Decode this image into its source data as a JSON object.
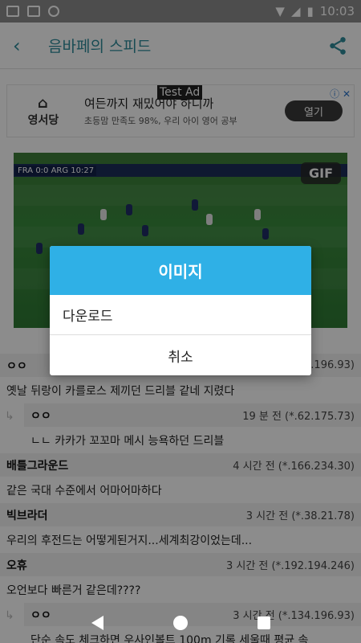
{
  "status_bar": {
    "time": "10:03"
  },
  "app_bar": {
    "title": "음바페의 스피드"
  },
  "ad": {
    "test_label": "Test Ad",
    "logo_text": "영서당",
    "headline": "여든까지 재밌어야 하니까",
    "subtext": "초등맘 만족도 98%, 우리 아이 영어 공부",
    "button_label": "열기",
    "info_glyph": "ⓘ ✕"
  },
  "media": {
    "badge": "GIF",
    "scorebug": "FRA 0:0 ARG 10:27"
  },
  "comments": [
    {
      "author": "ㅇㅇ",
      "meta": "(*.134.196.93)",
      "body": "옛날 뒤랑이 카를로스 제끼던 드리블 같네 지렸다",
      "reply": false
    },
    {
      "author": "ㅇㅇ",
      "meta": "19 분 전 (*.62.175.73)",
      "body": "ㄴㄴ 카카가 꼬꼬마 메시 능욕하던 드리블",
      "reply": true
    },
    {
      "author": "배틀그라운드",
      "meta": "4 시간 전 (*.166.234.30)",
      "body": "같은 국대 수준에서 어마어마하다",
      "reply": false
    },
    {
      "author": "빅브라더",
      "meta": "3 시간 전 (*.38.21.78)",
      "body": "우리의 후전드는 어떻게된거지...세계최강이었는데...",
      "reply": false
    },
    {
      "author": "오휴",
      "meta": "3 시간 전 (*.192.194.246)",
      "body": "오언보다 빠른거 같은데????",
      "reply": false
    },
    {
      "author": "ㅇㅇ",
      "meta": "3 시간 전 (*.134.196.93)",
      "body": "단순 속도 체크하면 우사인볼트 100m 기록 세울때 평균 속",
      "reply": true
    }
  ],
  "dialog": {
    "title": "이미지",
    "option_download": "다운로드",
    "cancel_label": "취소"
  },
  "colors": {
    "accent": "#2e8b9a",
    "dialog_header": "#2fb0e6"
  }
}
